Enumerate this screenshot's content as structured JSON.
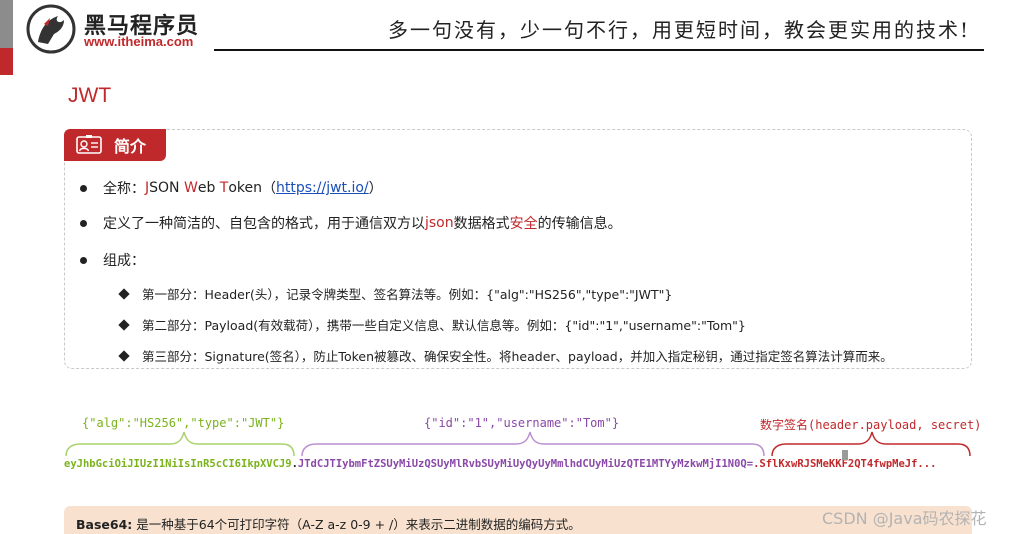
{
  "header": {
    "brand_name": "黑马程序员",
    "brand_url": "www.itheima.com",
    "slogan": "多一句没有，少一句不行，用更短时间，教会更实用的技术!"
  },
  "colors": {
    "accent": "#c0292b",
    "green": "#7ab31c",
    "purple": "#8a49a8",
    "link": "#1a4fb8",
    "note_bg": "#f8e2cf"
  },
  "page_title": "JWT",
  "intro": {
    "tag_label": "简介",
    "tag_icon": "id-card-icon",
    "bullet1": {
      "prefix": "全称：",
      "j": "J",
      "son": "SON ",
      "w": "W",
      "eb": "eb ",
      "t": "T",
      "oken": "oken ",
      "paren_open": "（",
      "link": "https://jwt.io/",
      "paren_close": "）"
    },
    "bullet2": {
      "a": "定义了一种简洁的、自包含的格式，用于通信双方以",
      "json": "json",
      "b": "数据格式",
      "safe": "安全",
      "c": "的传输信息。"
    },
    "bullet3": "组成：",
    "parts": [
      "第一部分：Header(头），记录令牌类型、签名算法等。例如：{\"alg\":\"HS256\",\"type\":\"JWT\"}",
      "第二部分：Payload(有效载荷），携带一些自定义信息、默认信息等。例如：{\"id\":\"1\",\"username\":\"Tom\"}",
      "第三部分：Signature(签名），防止Token被篡改、确保安全性。将header、payload，并加入指定秘钥，通过指定签名算法计算而来。"
    ]
  },
  "diagram": {
    "header_json": "{\"alg\":\"HS256\",\"type\":\"JWT\"}",
    "payload_json": "{\"id\":\"1\",\"username\":\"Tom\"}",
    "signature_label": "数字签名(header.payload, secret)",
    "token_header": "eyJhbGciOiJIUzI1NiIsInR5cCI6IkpXVCJ9",
    "token_dot": ".",
    "token_payload": "JTdCJTIybmFtZSUyMiUzQSUyMlRvbSUyMiUyQyUyMmlhdCUyMiUzQTE1MTYyMzkwMjI1N0Q=",
    "token_signature": ".SflKxwRJSMeKKF2QT4fwpMeJf..."
  },
  "note": {
    "title": "Base64:",
    "text": "是一种基于64个可打印字符（A-Z a-z 0-9 + /）来表示二进制数据的编码方式。"
  },
  "watermark": "CSDN @Java码农探花"
}
